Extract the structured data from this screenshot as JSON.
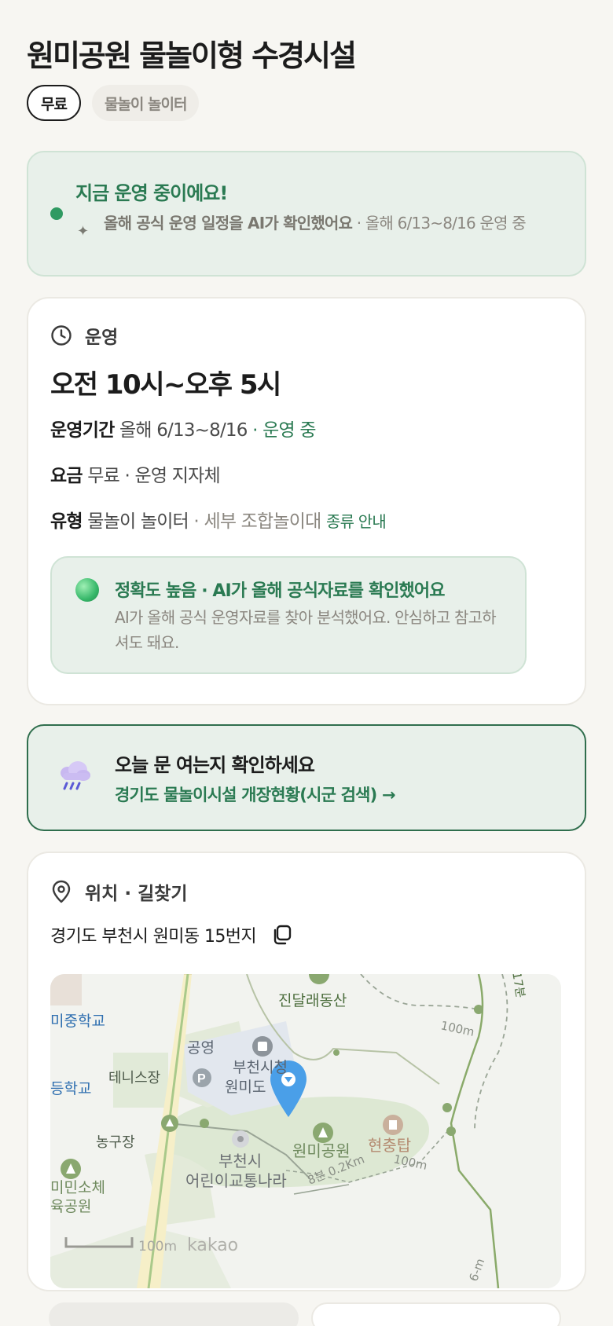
{
  "page": {
    "title": "원미공원 물놀이형 수경시설",
    "tags": [
      "무료",
      "물놀이 놀이터"
    ]
  },
  "status": {
    "title": "지금 운영 중이에요!",
    "ai_note": "올해 공식 운영 일정을 AI가 확인했어요",
    "period_note": " · 올해 6/13~8/16 운영 중"
  },
  "ops": {
    "section_label": "운영",
    "hours": "오전 10시~오후 5시",
    "period_label": "운영기간",
    "period_value": "올해 6/13~8/16",
    "period_status": " · 운영 중",
    "fee_label": "요금",
    "fee_value": "무료 · 운영 지자체",
    "type_label": "유형",
    "type_value": "물놀이 놀이터",
    "type_detail": " · 세부 조합놀이대",
    "type_link": "종류 안내",
    "accuracy_title": "정확도 높음 · AI가 올해 공식자료를 확인했어요",
    "accuracy_desc": "AI가 올해 공식 운영자료를 찾아 분석했어요. 안심하고 참고하셔도 돼요."
  },
  "check": {
    "title": "오늘 문 여는지 확인하세요",
    "link": "경기도 물놀이시설 개장현황(시군 검색) →"
  },
  "location": {
    "section_label": "위치 · 길찾기",
    "address": "경기도 부천시 원미동 15번지",
    "map": {
      "labels": [
        "진달래동산",
        "미중학교",
        "공영",
        "부천시청",
        "원미도",
        "테니스장",
        "등학교",
        "농구장",
        "부천시",
        "어린이교통나라",
        "원미공원",
        "현충탑",
        "미민소체",
        "육공원",
        "100m",
        "100m",
        "8분 0.2Km",
        "17분",
        "6-m"
      ],
      "scale": "100m",
      "brand": "kakao"
    }
  },
  "colors": {
    "accent": "#2a7a52",
    "status_bg": "#e8f0ea",
    "marker": "#4a9fe8"
  }
}
